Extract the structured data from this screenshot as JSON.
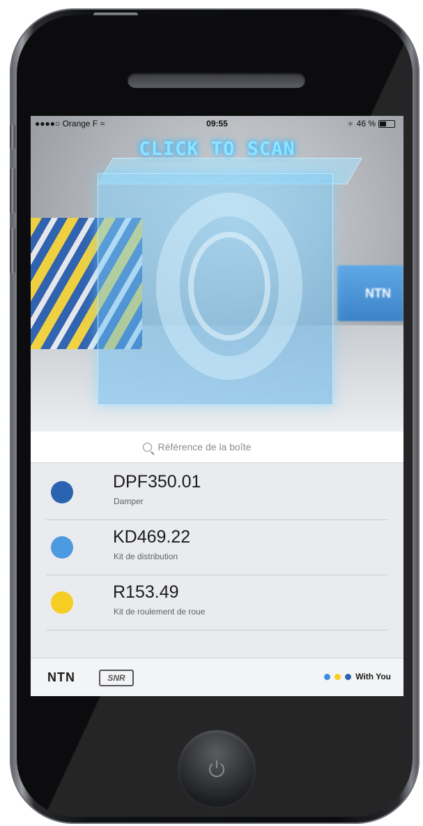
{
  "status_bar": {
    "carrier": "●●●●○ Orange F",
    "time": "09:55",
    "battery": "46 %",
    "battery_level": 0.46
  },
  "hero": {
    "scan_label": "CLICK TO SCAN",
    "box_brand": "NTN"
  },
  "search": {
    "placeholder": "Référence de la boîte"
  },
  "items": [
    {
      "ref": "DPF350.01",
      "desc": "Damper",
      "color": "#2a64b0"
    },
    {
      "ref": "KD469.22",
      "desc": "Kit de distribution",
      "color": "#4c9ae0"
    },
    {
      "ref": "R153.49",
      "desc": "Kit de roulement de roue",
      "color": "#f6cd22"
    }
  ],
  "footer": {
    "logo_ntn": "NTN",
    "logo_snr": "SNR",
    "tagline": "With You",
    "dot_colors": [
      "#3a8ee0",
      "#f6cd22",
      "#2a64b0"
    ]
  }
}
